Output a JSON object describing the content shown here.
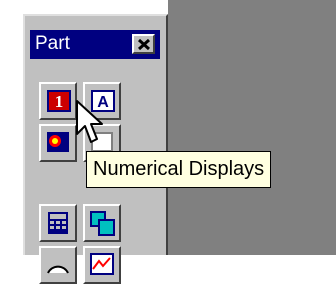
{
  "palette": {
    "title": "Part",
    "close_glyph": "×",
    "tools": [
      {
        "icon": "numeric-display-icon",
        "glyph": "1"
      },
      {
        "icon": "text-display-icon",
        "glyph": "A"
      },
      {
        "icon": "indicator-icon"
      },
      {
        "icon": "frame-icon"
      },
      {
        "icon": "calculator-icon"
      },
      {
        "icon": "overlay-windows-icon"
      },
      {
        "icon": "meter-icon"
      },
      {
        "icon": "graph-icon"
      }
    ]
  },
  "tooltip": {
    "text": "Numerical Displays"
  },
  "colors": {
    "titlebar": "#000080",
    "face": "#c0c0c0",
    "tooltip_bg": "#ffffe1",
    "background": "#808080"
  }
}
